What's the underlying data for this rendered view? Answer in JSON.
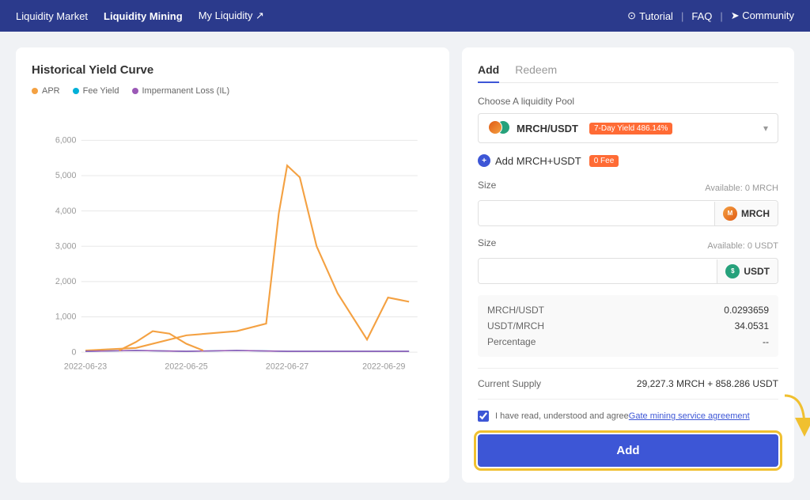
{
  "header": {
    "nav_items": [
      {
        "label": "Liquidity Market",
        "active": false
      },
      {
        "label": "Liquidity Mining",
        "active": true
      },
      {
        "label": "My Liquidity ↗",
        "active": false
      }
    ],
    "right_items": [
      {
        "label": "Tutorial",
        "icon": "circle-icon"
      },
      {
        "label": "|"
      },
      {
        "label": "FAQ"
      },
      {
        "label": "|"
      },
      {
        "label": "➤ Community"
      }
    ]
  },
  "chart": {
    "title": "Historical Yield Curve",
    "legend": [
      {
        "label": "APR",
        "color": "#f4a142"
      },
      {
        "label": "Fee Yield",
        "color": "#00b0d8"
      },
      {
        "label": "Impermanent Loss (IL)",
        "color": "#9b59b6"
      }
    ],
    "y_labels": [
      "6,000",
      "5,000",
      "4,000",
      "3,000",
      "2,000",
      "1,000",
      "0"
    ],
    "x_labels": [
      "2022-06-23",
      "2022-06-25",
      "2022-06-27",
      "2022-06-29"
    ]
  },
  "right_panel": {
    "tabs": [
      {
        "label": "Add",
        "active": true
      },
      {
        "label": "Redeem",
        "active": false
      }
    ],
    "pool_label": "Choose A liquidity Pool",
    "pool_name": "MRCH/USDT",
    "pool_yield": "7-Day Yield 486.14%",
    "add_pool_text": "Add MRCH+USDT",
    "fee_badge": "0 Fee",
    "size_label": "Size",
    "available_mrch": "Available: 0 MRCH",
    "available_usdt": "Available: 0 USDT",
    "currency_mrch": "MRCH",
    "currency_usdt": "USDT",
    "info_rows": [
      {
        "key": "MRCH/USDT",
        "value": "0.0293659"
      },
      {
        "key": "USDT/MRCH",
        "value": "34.0531"
      },
      {
        "key": "Percentage",
        "value": "--"
      }
    ],
    "supply_label": "Current Supply",
    "supply_value": "29,227.3 MRCH + 858.286 USDT",
    "agreement_text": "I have read, understood and agree",
    "agreement_link": "Gate mining service agreement",
    "add_button": "Add"
  }
}
